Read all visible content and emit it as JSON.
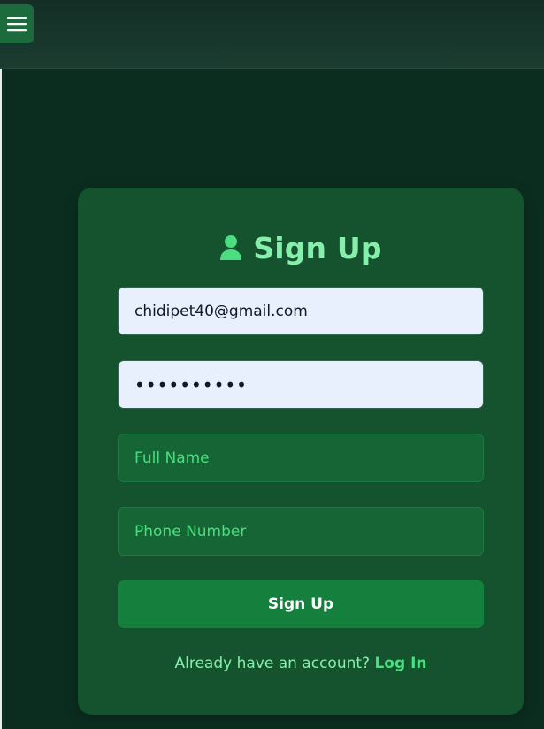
{
  "header": {
    "menu_icon": "hamburger-menu-icon"
  },
  "signup": {
    "title": "Sign Up",
    "title_icon": "user-icon",
    "email_value": "chidipet40@gmail.com",
    "password_value": "••••••••••",
    "full_name_placeholder": "Full Name",
    "phone_placeholder": "Phone Number",
    "submit_label": "Sign Up",
    "footer_text": "Already have an account?",
    "login_link": "Log In"
  },
  "colors": {
    "page_background": "#0b2d20",
    "card_background": "#14532d",
    "accent_text": "#86efac",
    "link": "#4ade80",
    "button": "#15803d"
  }
}
